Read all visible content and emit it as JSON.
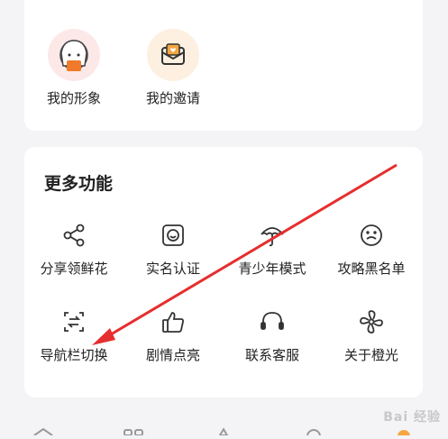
{
  "profile_section": {
    "items": [
      {
        "label": "我的形象",
        "icon": "avatar-girl-icon",
        "bg": "#fde8e8"
      },
      {
        "label": "我的邀请",
        "icon": "envelope-heart-icon",
        "bg": "#fdf0e0"
      }
    ]
  },
  "more_section": {
    "title": "更多功能",
    "items": [
      {
        "label": "分享领鲜花",
        "icon": "share-icon"
      },
      {
        "label": "实名认证",
        "icon": "id-face-icon"
      },
      {
        "label": "青少年模式",
        "icon": "umbrella-icon"
      },
      {
        "label": "攻略黑名单",
        "icon": "blacklist-face-icon"
      },
      {
        "label": "导航栏切换",
        "icon": "nav-switch-icon"
      },
      {
        "label": "剧情点亮",
        "icon": "thumbs-up-icon"
      },
      {
        "label": "联系客服",
        "icon": "headset-icon"
      },
      {
        "label": "关于橙光",
        "icon": "fan-icon"
      }
    ]
  },
  "annotation": {
    "color": "#e62e2e"
  },
  "watermark": {
    "text": "Bai 经验"
  }
}
